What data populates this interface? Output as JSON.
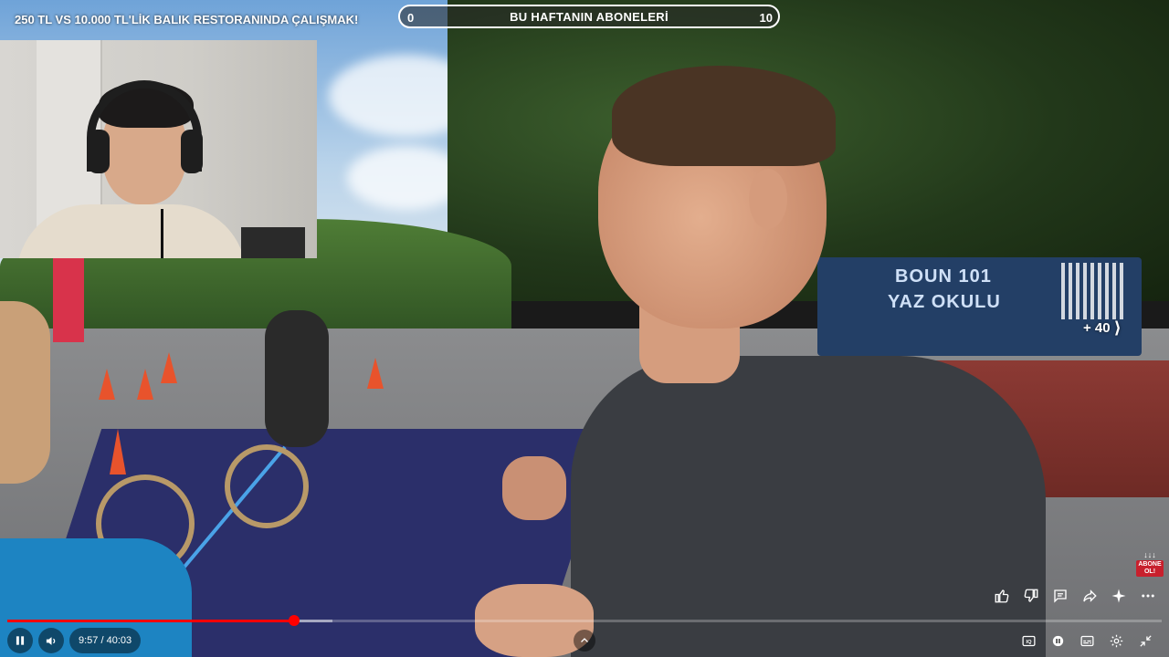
{
  "video": {
    "title": "250 TL VS 10.000 TL'LİK BALIK RESTORANINDA ÇALIŞMAK!"
  },
  "subscriber_goal": {
    "label": "BU HAFTANIN ABONELERİ",
    "min": "0",
    "max": "10",
    "progress_fraction": 0.0
  },
  "scene_banner": {
    "line1": "BOUN 101",
    "line2": "YAZ OKULU"
  },
  "more_counter": {
    "label": "+ 40"
  },
  "subscribe_badge": {
    "arrows": "↓↓↓",
    "text": "ABONE OL!"
  },
  "actions": [
    {
      "name": "like-button",
      "icon": "thumbs-up-icon"
    },
    {
      "name": "dislike-button",
      "icon": "thumbs-down-icon"
    },
    {
      "name": "comments-button",
      "icon": "comment-icon"
    },
    {
      "name": "share-button",
      "icon": "share-icon"
    },
    {
      "name": "ask-button",
      "icon": "sparkle-icon"
    },
    {
      "name": "more-button",
      "icon": "more-dots-icon"
    }
  ],
  "player": {
    "time": "9:57 / 40:03",
    "played_fraction": 0.2485,
    "buffered_fraction": 0.282
  },
  "colors": {
    "progress_played": "#ff0000",
    "subscribe_badge": "#c8202d",
    "banner": "#233f66"
  }
}
